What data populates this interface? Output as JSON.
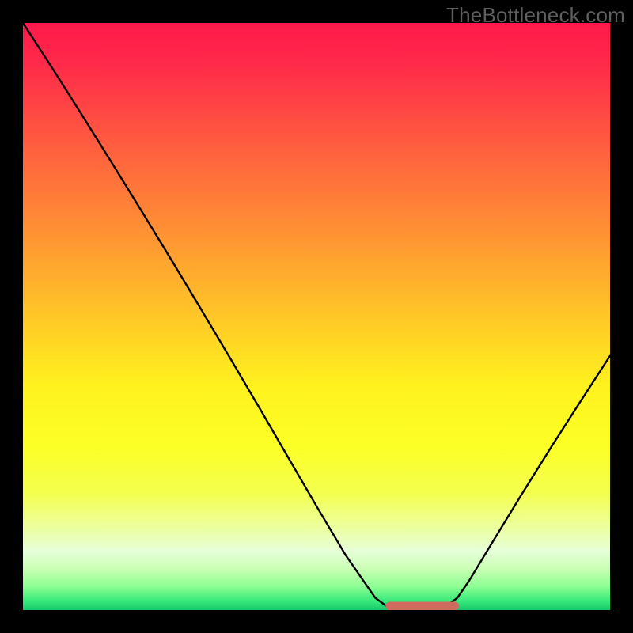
{
  "watermark": "TheBottleneck.com",
  "chart_data": {
    "type": "line",
    "title": "",
    "xlabel": "",
    "ylabel": "",
    "xlim": [
      0,
      100
    ],
    "ylim": [
      0,
      100
    ],
    "grid": false,
    "legend": false,
    "series": [
      {
        "name": "bottleneck-curve",
        "x": [
          0,
          5,
          10,
          15,
          20,
          25,
          30,
          35,
          40,
          45,
          50,
          55,
          60,
          62,
          64,
          66,
          68,
          70,
          72,
          74,
          76,
          80,
          85,
          90,
          95,
          100
        ],
        "y": [
          100,
          92.3,
          84.4,
          76.4,
          68.3,
          60.1,
          51.8,
          43.4,
          34.9,
          26.3,
          17.7,
          9.3,
          2.1,
          0.6,
          0.0,
          0.0,
          0.0,
          0.0,
          0.6,
          2.1,
          5.0,
          11.6,
          19.8,
          27.8,
          35.6,
          43.3
        ]
      }
    ],
    "valley_marker": {
      "x_start": 62.5,
      "x_end": 73.5,
      "y": 0,
      "color": "#d16a5f"
    },
    "gradient_stops": [
      {
        "pos": 0.0,
        "color": "#ff1a4b"
      },
      {
        "pos": 0.07,
        "color": "#ff2a4a"
      },
      {
        "pos": 0.2,
        "color": "#ff5a40"
      },
      {
        "pos": 0.35,
        "color": "#ff8f34"
      },
      {
        "pos": 0.5,
        "color": "#ffc728"
      },
      {
        "pos": 0.62,
        "color": "#fff21e"
      },
      {
        "pos": 0.72,
        "color": "#fcff25"
      },
      {
        "pos": 0.8,
        "color": "#f3ff4e"
      },
      {
        "pos": 0.86,
        "color": "#ecffa0"
      },
      {
        "pos": 0.9,
        "color": "#e6ffd8"
      },
      {
        "pos": 0.93,
        "color": "#c9ffb4"
      },
      {
        "pos": 0.96,
        "color": "#8dff93"
      },
      {
        "pos": 0.985,
        "color": "#35e87a"
      },
      {
        "pos": 1.0,
        "color": "#18c76a"
      }
    ]
  }
}
